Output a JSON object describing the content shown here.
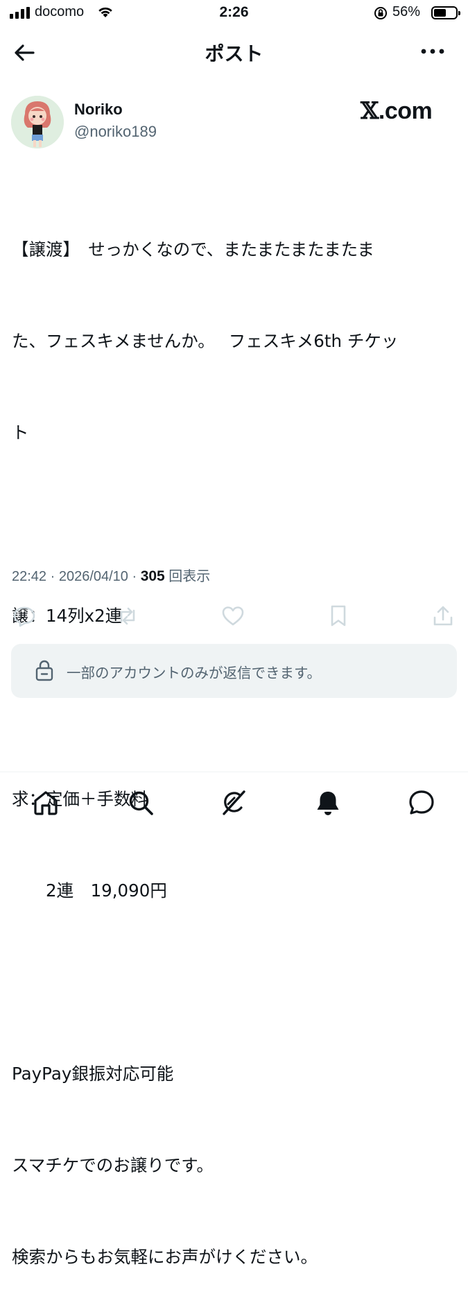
{
  "status_bar": {
    "carrier": "docomo",
    "time": "2:26",
    "battery_percent": "56%",
    "battery_level": 0.56
  },
  "header": {
    "title": "ポスト"
  },
  "author": {
    "name": "Noriko",
    "handle": "@noriko189"
  },
  "watermark": {
    "x": "𝕏",
    "domain": ".com"
  },
  "post": {
    "lines": [
      "【譲渡】　せっかくなので、またまたまたまたま",
      "た、フェスキメませんか。　 フェスキメ6th チケッ",
      "ト",
      "",
      "譲：14列x2連",
      "",
      "求：定価＋手数料",
      "　　2連　19,090円",
      "",
      "PayPay銀振対応可能",
      "スマチケでのお譲りです。",
      "検索からもお気軽にお声がけください。"
    ],
    "timestamp": "22:42 · 2026/04/10 · ",
    "views_count": "305",
    "views_label": " 回表示"
  },
  "reply_restriction": {
    "text": "一部のアカウントのみが返信できます。"
  },
  "icons": {
    "back": "arrow-left-icon",
    "more": "more-horizontal-icon",
    "reply": "reply-icon",
    "repost": "repost-icon",
    "like": "heart-icon",
    "bookmark": "bookmark-icon",
    "share": "share-icon",
    "lock": "lock-icon",
    "home": "home-icon",
    "search": "search-icon",
    "grok": "grok-icon",
    "notifications": "bell-icon",
    "messages": "message-icon"
  },
  "colors": {
    "text": "#0f1419",
    "secondary": "#536471",
    "muted_icon": "#cfd9de",
    "restricted_bg": "#eff3f4"
  }
}
